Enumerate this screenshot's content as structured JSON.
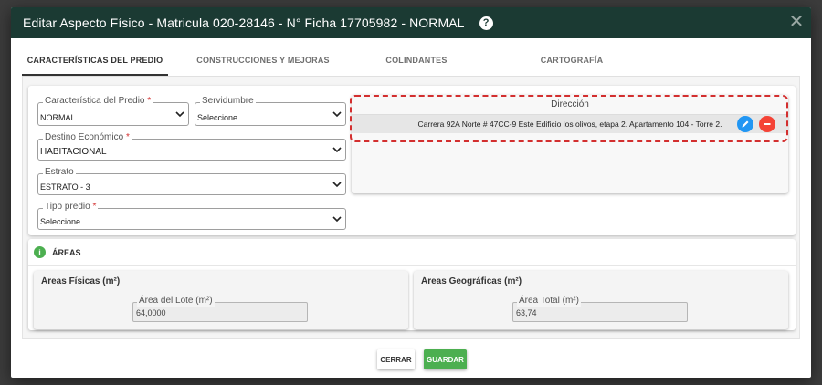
{
  "modal": {
    "title": "Editar Aspecto Físico - Matricula 020-28146 - N° Ficha 17705982 - NORMAL",
    "help_icon": "help-circle-icon",
    "close_icon": "close-icon",
    "header_color": "#1b3a33"
  },
  "tabs": [
    {
      "label": "CARACTERÍSTICAS DEL PREDIO",
      "active": true
    },
    {
      "label": "CONSTRUCCIONES Y MEJORAS",
      "active": false
    },
    {
      "label": "COLINDANTES",
      "active": false
    },
    {
      "label": "CARTOGRAFÍA",
      "active": false
    }
  ],
  "predio": {
    "caracteristica": {
      "label": "Característica del Predio",
      "required": "*",
      "value": "NORMAL"
    },
    "servidumbre": {
      "label": "Servidumbre",
      "value": "Seleccione"
    },
    "destino": {
      "label": "Destino Económico",
      "required": "*",
      "value": "HABITACIONAL"
    },
    "estrato": {
      "label": "Estrato",
      "value": "ESTRATO - 3"
    },
    "tipo_predio": {
      "label": "Tipo predio",
      "required": "*",
      "value": "Seleccione"
    }
  },
  "direccion": {
    "header": "Dirección",
    "rows": [
      {
        "text": "Carrera 92A Norte # 47CC-9 Este Edificio los olivos, etapa 2. Apartamento 104 - Torre 2."
      }
    ],
    "edit_icon": "pencil-icon",
    "delete_icon": "minus-circle-icon",
    "highlight_color": "#d32f2f"
  },
  "areas": {
    "title": "ÁREAS",
    "info_icon": "info-icon",
    "fisicas": {
      "title": "Áreas Físicas (m²)",
      "field_label": "Área del Lote (m²)",
      "value": "64,0000"
    },
    "geograficas": {
      "title": "Áreas Geográficas (m²)",
      "field_label": "Área Total (m²)",
      "value": "63,74"
    }
  },
  "footer": {
    "cerrar": "CERRAR",
    "guardar": "GUARDAR",
    "guardar_color": "#4caf50"
  }
}
